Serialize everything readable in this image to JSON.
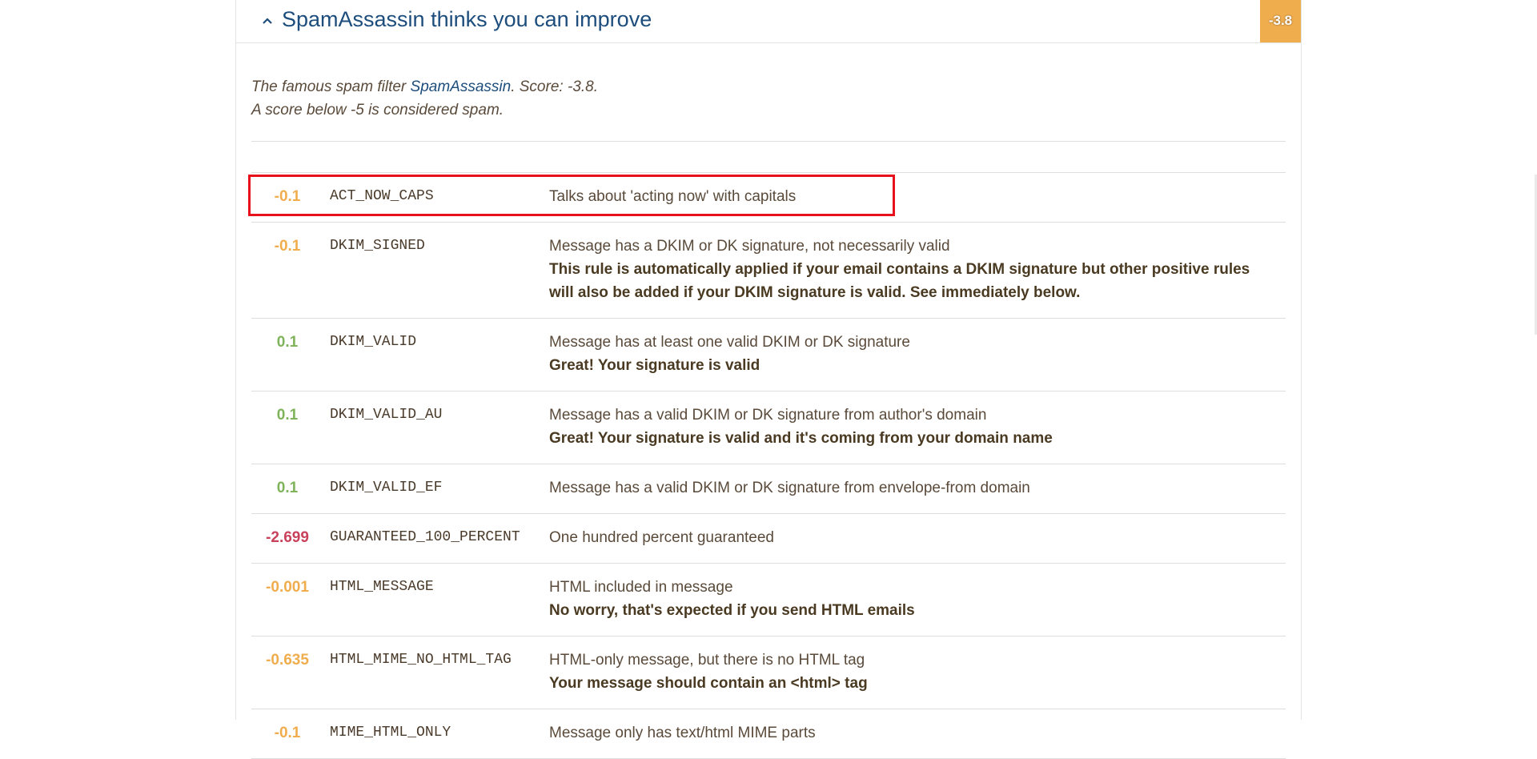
{
  "panel": {
    "title": "SpamAssassin thinks you can improve",
    "score_badge": "-3.8",
    "intro_prefix": "The famous spam filter ",
    "intro_link": "SpamAssassin",
    "intro_suffix": ". Score: -3.8.",
    "intro_line2": "A score below -5 is considered spam."
  },
  "colors": {
    "badge": "#f0ad4e",
    "title": "#1d4d7c",
    "negative_score": "#f0ad4e",
    "positive_score": "#7fb35a",
    "bad_score": "#c9415a",
    "highlight": "#e8101a"
  },
  "rules": [
    {
      "score": "-0.1",
      "name": "ACT_NOW_CAPS",
      "desc": "Talks about 'acting now' with capitals",
      "note": ""
    },
    {
      "score": "-0.1",
      "name": "DKIM_SIGNED",
      "desc": "Message has a DKIM or DK signature, not necessarily valid",
      "note": "This rule is automatically applied if your email contains a DKIM signature but other positive rules will also be added if your DKIM signature is valid. See immediately below."
    },
    {
      "score": "0.1",
      "name": "DKIM_VALID",
      "desc": "Message has at least one valid DKIM or DK signature",
      "note": "Great! Your signature is valid"
    },
    {
      "score": "0.1",
      "name": "DKIM_VALID_AU",
      "desc": "Message has a valid DKIM or DK signature from author's domain",
      "note": "Great! Your signature is valid and it's coming from your domain name"
    },
    {
      "score": "0.1",
      "name": "DKIM_VALID_EF",
      "desc": "Message has a valid DKIM or DK signature from envelope-from domain",
      "note": ""
    },
    {
      "score": "-2.699",
      "name": "GUARANTEED_100_PERCENT",
      "desc": "One hundred percent guaranteed",
      "note": ""
    },
    {
      "score": "-0.001",
      "name": "HTML_MESSAGE",
      "desc": "HTML included in message",
      "note": "No worry, that's expected if you send HTML emails"
    },
    {
      "score": "-0.635",
      "name": "HTML_MIME_NO_HTML_TAG",
      "desc": "HTML-only message, but there is no HTML tag",
      "note": "Your message should contain an <html> tag"
    },
    {
      "score": "-0.1",
      "name": "MIME_HTML_ONLY",
      "desc": "Message only has text/html MIME parts",
      "note": ""
    }
  ],
  "rule_score_class": [
    "neg",
    "neg",
    "pos",
    "pos",
    "pos",
    "bad",
    "neg",
    "neg",
    "neg"
  ]
}
